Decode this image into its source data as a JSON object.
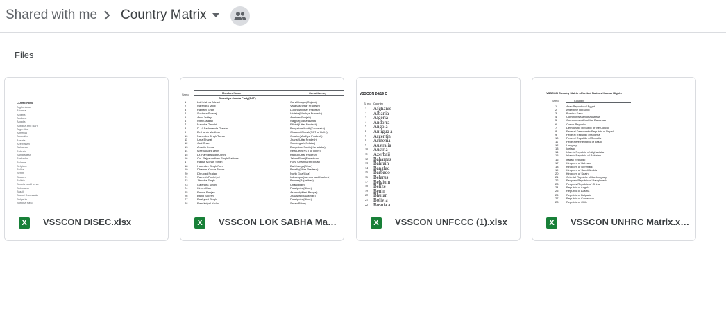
{
  "breadcrumb": {
    "root": "Shared with me",
    "current": "Country Matrix"
  },
  "section_label": "Files",
  "files": [
    {
      "name": "VSSCON DISEC.xlsx",
      "icon": "excel-icon",
      "icon_letter": "X",
      "icon_color": "#188038"
    },
    {
      "name": "VSSCON LOK SABHA Matri...",
      "icon": "excel-icon",
      "icon_letter": "X",
      "icon_color": "#188038"
    },
    {
      "name": "VSSCON UNFCCC (1).xlsx",
      "icon": "excel-icon",
      "icon_letter": "X",
      "icon_color": "#188038"
    },
    {
      "name": "VSSCON UNHRC Matrix.xlsx",
      "icon": "excel-icon",
      "icon_letter": "X",
      "icon_color": "#188038"
    }
  ],
  "thumbnails": {
    "disec": {
      "header": "COUNTRIES",
      "rows": [
        "Afghanistan",
        "Albania",
        "Algeria",
        "Andorra",
        "Angola",
        "Antigua and Barb",
        "Argentina",
        "Armenia",
        "Australia",
        "Austria",
        "Azerbaijan",
        "Bahamas",
        "Bahrain",
        "Bangladesh",
        "Barbados",
        "Belarus",
        "Belgium",
        "Belize",
        "Benin",
        "Bhutan",
        "Bolivia",
        "Bosnia and Herze",
        "Botswana",
        "Brazil",
        "Brunei Darussala",
        "Bulgaria",
        "Burkina Faso"
      ]
    },
    "loksabha": {
      "col_sno": "Sr no.",
      "col_member": "Member Name",
      "col_constituency": "Constituency",
      "party": "Bharatiya Janata Party(BJP)",
      "members": [
        "Lal Krishna Advani",
        "Narendra Modi",
        "Rajnath Singh",
        "Sushma Swaraj",
        "Arun Jaitley",
        "Nitin Gadkari",
        "Maneka Gandhi",
        "D. V. Sadananda Gowda",
        "Dr. Harsh Vardhan",
        "Narendra Singh Tomar",
        "Uma Bharati",
        "Jual Oram",
        "Ananth Kumar",
        "Meenakashi Lekhi",
        "Dr. Ram Bahadur Joshi",
        "Col. Rajyavardhan Singh Rathore",
        "Radha Mohan Singh",
        "Hukmdev Singh Ram",
        "Dharam Kumar Tomar",
        "Dhrupad Pratap",
        "Ramesh Pokhriyal",
        "Jitendra Singh",
        "Gajendra Singh",
        "Kirron Kher",
        "Prema Ranjan",
        "Babul Supriyo",
        "Dushyant Singh",
        "Ram Kripal Yadav"
      ],
      "constituencies": [
        "Gandhinagar(Gujarat)",
        "Varanasi(Uttar Pradesh)",
        "Lucknow(Uttar Pradesh)",
        "Vidisha(Madhya Pradesh)",
        "Amritsar(Punjab)",
        "Nagpur(Maharashtra)",
        "Pilibhit(Uttar Pradesh)",
        "Bangalore North(Karnataka)",
        "Chandni Chowk(NCT of Delhi)",
        "Gwalior(Madhya Pradesh)",
        "Jhansi(Uttar Pradesh)",
        "Sundargarh(Odisha)",
        "Bangalore South(Karnataka)",
        "New Delhi(NCT of Delhi)",
        "Katpur(Uttar Pradesh)",
        "Jaipur Rural(Rajasthan)",
        "Purvi Champaran(Bihar)",
        "Darbhanga(Bihar)",
        "Bareilly(Uttar Pradesh)",
        "North Goa(Goa)",
        "Udhampur(Jammu and Kashmir)",
        "Barmer(Rajasthan)",
        "Chandigarh",
        "Pataliputra(Bihar)",
        "Asansol(West Bengal)",
        "Jhalawar(Rajasthan)",
        "Pataliputra(Bihar)",
        "Saran(Bihar)"
      ]
    },
    "unfccc": {
      "title": "VSSCON 24/19 C",
      "col_sno": "Sr no.",
      "col_country": "Country",
      "rows": [
        "Afghanis",
        "Albania",
        "Algeria",
        "Andorra",
        "Angola",
        "Antigua a",
        "Argentin",
        "Armenia",
        "Australia",
        "Austria",
        "Azerbaij",
        "Bahamas",
        "Bahrain",
        "Banglad",
        "Barbado",
        "Belarus",
        "Belgium",
        "Belize",
        "Benin",
        "Bhutan",
        "Bolivia",
        "Bosnia a"
      ]
    },
    "unhrc": {
      "title": "VSSCON Country Matrix of United Nations Human Rights",
      "col_sno": "Sr no.",
      "col_country": "Country",
      "rows": [
        "Arab Republic of Egypt",
        "Argentine Republic",
        "Burkina Faso",
        "Commonwealth of Australia",
        "Commonwealth of the Bahamas",
        "Czech Republic",
        "Democratic Republic of the Congo",
        "Federal Democratic Republic of Nepal",
        "Federal Republic of Nigeria",
        "Federal Republic of Somalia",
        "Federative Republic of Brazil",
        "Hungary",
        "Iceland",
        "Islamic Republic of Afghanistan",
        "Islamic Republic of Pakistan",
        "Italian Republic",
        "Kingdom of Bahrain",
        "Kingdom of Denmark",
        "Kingdom of Saudi Arabia",
        "Kingdom of Spain",
        "Oriental Republic of the Uruguay",
        "People's Republic of Bangladesh",
        "People's Republic of China",
        "Republic of Angola",
        "Republic of Austria",
        "Republic of Bulgaria",
        "Republic of Cameroon",
        "Republic of Chile"
      ]
    }
  }
}
